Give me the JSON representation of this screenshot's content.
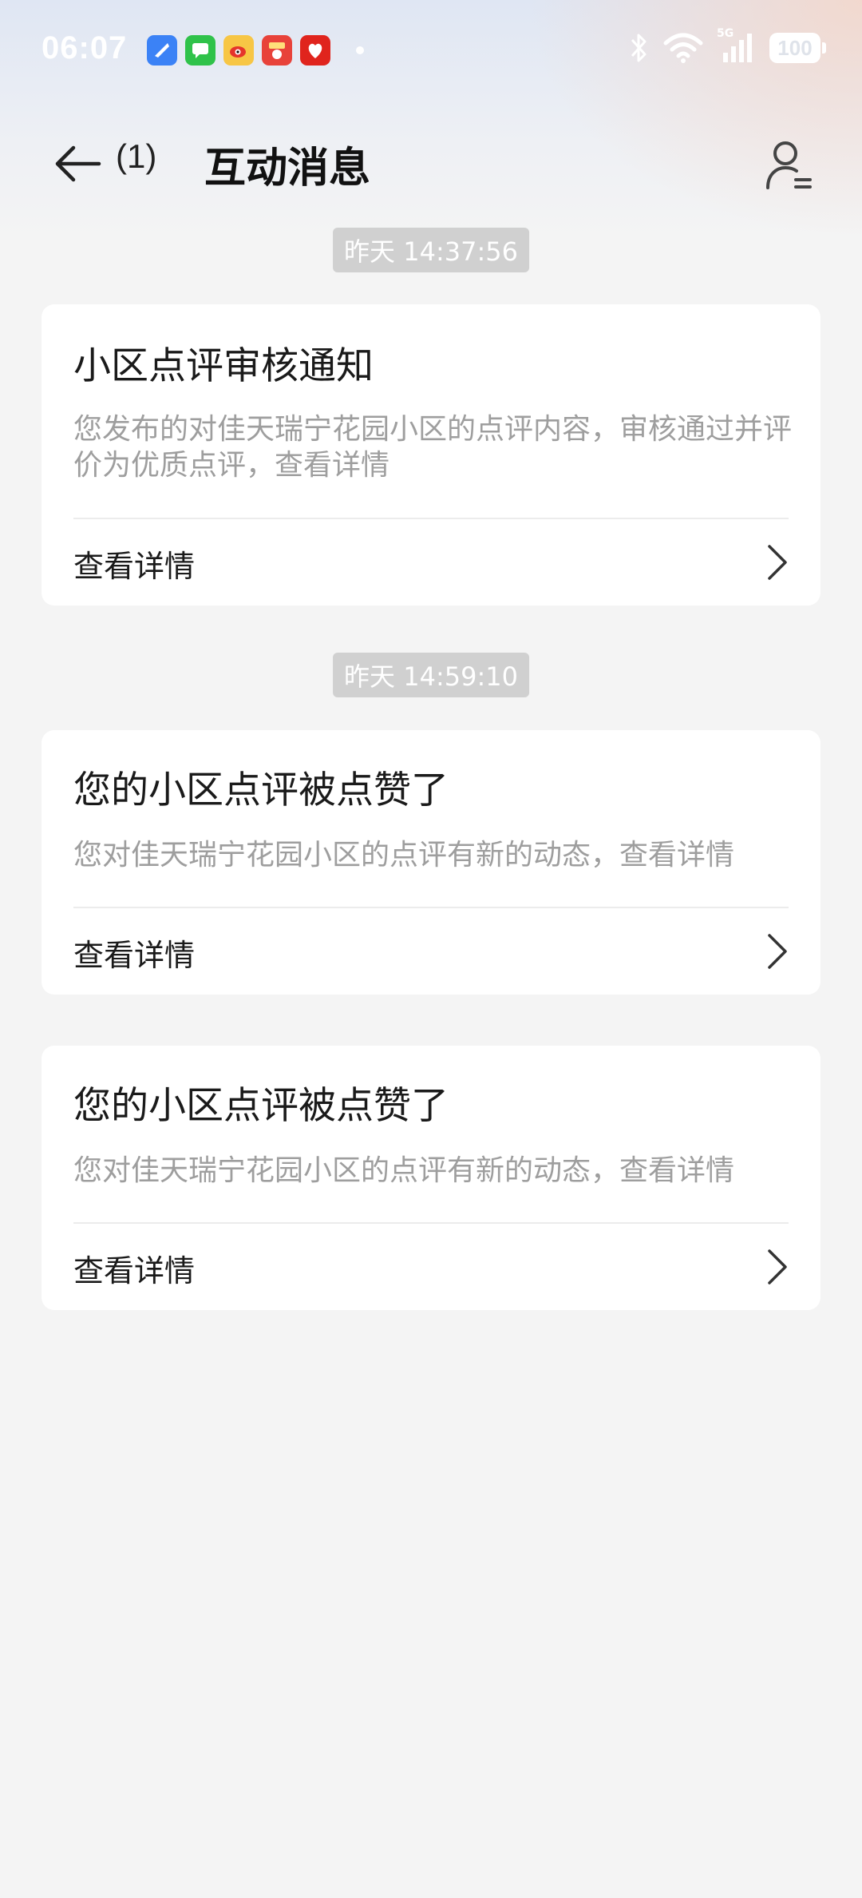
{
  "status_bar": {
    "time": "06:07",
    "network_label": "5G",
    "battery": "100",
    "notification_apps": [
      "browser-app-icon",
      "messages-app-icon",
      "weibo-app-icon",
      "game-app-icon",
      "pinduoduo-app-icon"
    ]
  },
  "header": {
    "back_count": "(1)",
    "title": "互动消息"
  },
  "messages": [
    {
      "timestamp": "昨天 14:37:56",
      "title": "小区点评审核通知",
      "body": "您发布的对佳天瑞宁花园小区的点评内容，审核通过并评价为优质点评，查看详情",
      "action": "查看详情"
    },
    {
      "timestamp": "昨天 14:59:10",
      "title": "您的小区点评被点赞了",
      "body": "您对佳天瑞宁花园小区的点评有新的动态，查看详情",
      "action": "查看详情"
    },
    {
      "title": "您的小区点评被点赞了",
      "body": "您对佳天瑞宁花园小区的点评有新的动态，查看详情",
      "action": "查看详情"
    }
  ],
  "colors": {
    "background": "#f4f4f4",
    "card": "#ffffff",
    "timestamp_chip": "#d0d0d0",
    "title_text": "#1a1a1a",
    "body_text": "#9e9e9e"
  }
}
